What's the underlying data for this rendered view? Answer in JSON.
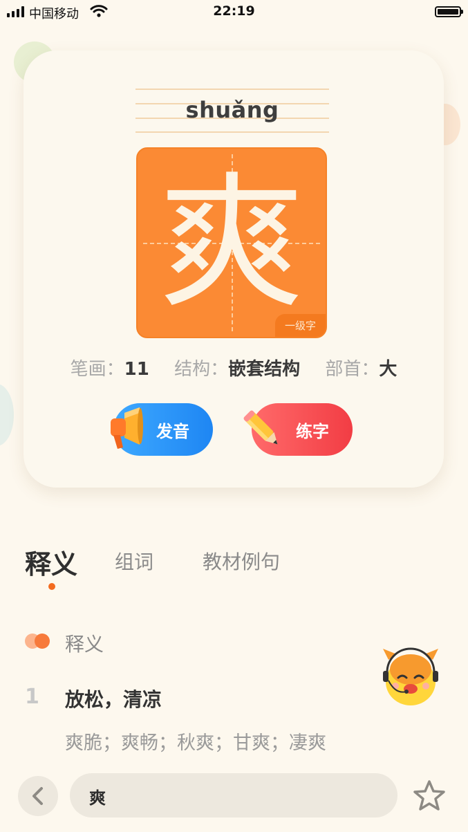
{
  "status_bar": {
    "carrier": "中国移动",
    "time": "22:19"
  },
  "card": {
    "pinyin": "shuǎng",
    "character": "爽",
    "level_tag": "一级字",
    "strokes_label": "笔画：",
    "strokes_value": "11",
    "structure_label": "结构：",
    "structure_value": "嵌套结构",
    "radical_label": "部首：",
    "radical_value": "大",
    "pronounce_button": "发音",
    "practice_button": "练字"
  },
  "tabs": [
    {
      "label": "释义",
      "active": true
    },
    {
      "label": "组词",
      "active": false
    },
    {
      "label": "教材例句",
      "active": false
    }
  ],
  "definition_section": {
    "title": "释义",
    "items": [
      {
        "number": "1",
        "meaning": "放松，清凉",
        "words": "爽脆；爽畅；秋爽；甘爽；凄爽"
      }
    ]
  },
  "bottom_bar": {
    "search_value": "爽"
  },
  "colors": {
    "accent_orange": "#fb8a34",
    "voice_blue": "#1e86f3",
    "practice_red": "#f23d44",
    "background": "#fdf8ee"
  },
  "icons": [
    "signal-icon",
    "wifi-icon",
    "battery-icon",
    "megaphone-icon",
    "pencil-icon",
    "mascot-icon",
    "back-arrow-icon",
    "star-icon"
  ]
}
